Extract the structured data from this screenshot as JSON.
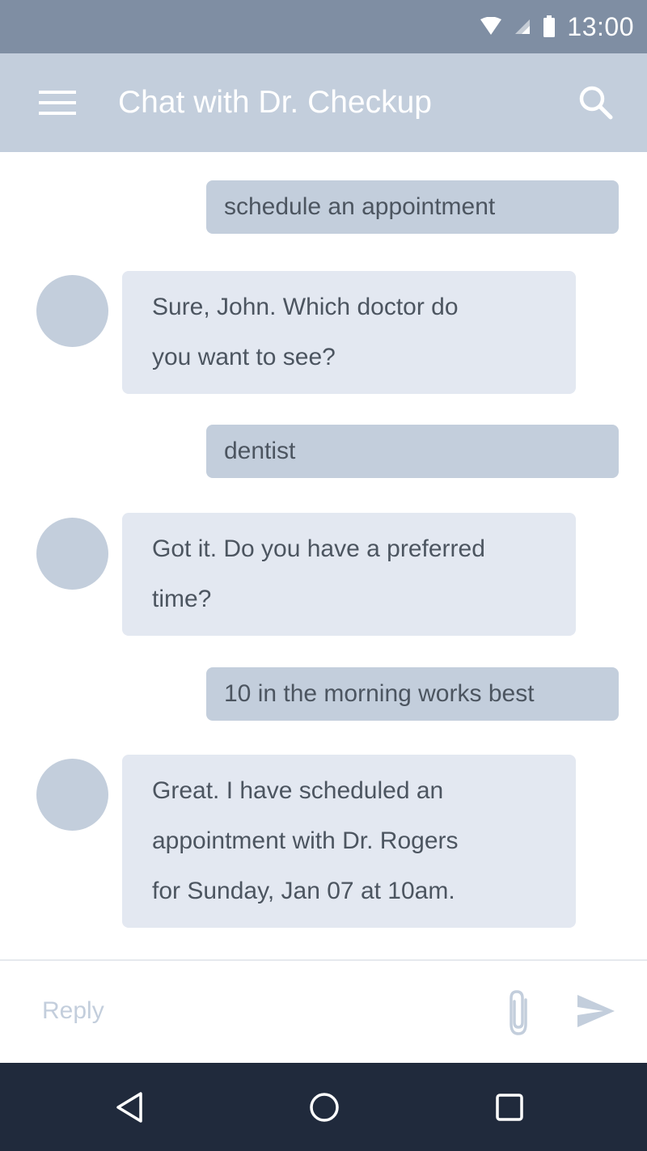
{
  "status_bar": {
    "time": "13:00",
    "icons": [
      "wifi-icon",
      "cell-signal-icon",
      "battery-icon"
    ]
  },
  "app_bar": {
    "title": "Chat with Dr. Checkup",
    "icons": [
      "menu-icon",
      "search-icon"
    ]
  },
  "messages": [
    {
      "sender": "user",
      "text": "schedule an appointment"
    },
    {
      "sender": "bot",
      "lines": [
        "Sure, John. Which doctor do",
        "you want to see?"
      ]
    },
    {
      "sender": "user",
      "text": "dentist"
    },
    {
      "sender": "bot",
      "lines": [
        "Got it. Do you have a preferred",
        "time?"
      ]
    },
    {
      "sender": "user",
      "text": "10 in the morning works best"
    },
    {
      "sender": "bot",
      "lines": [
        "Great. I have scheduled an",
        "appointment with Dr. Rogers",
        "for Sunday, Jan 07 at 10am."
      ]
    }
  ],
  "composer": {
    "placeholder": "Reply",
    "icons": [
      "paperclip-icon",
      "send-icon"
    ]
  },
  "nav_bar": {
    "icons": [
      "back-icon",
      "home-icon",
      "recents-icon"
    ]
  },
  "colors": {
    "status_bar": "#7f8ea3",
    "app_bar": "#c3cedc",
    "user_bubble": "#c3cedc",
    "bot_bubble": "#e3e8f1",
    "avatar": "#c3cedc",
    "nav_bar": "#202a3c",
    "text": "#4c5560"
  }
}
